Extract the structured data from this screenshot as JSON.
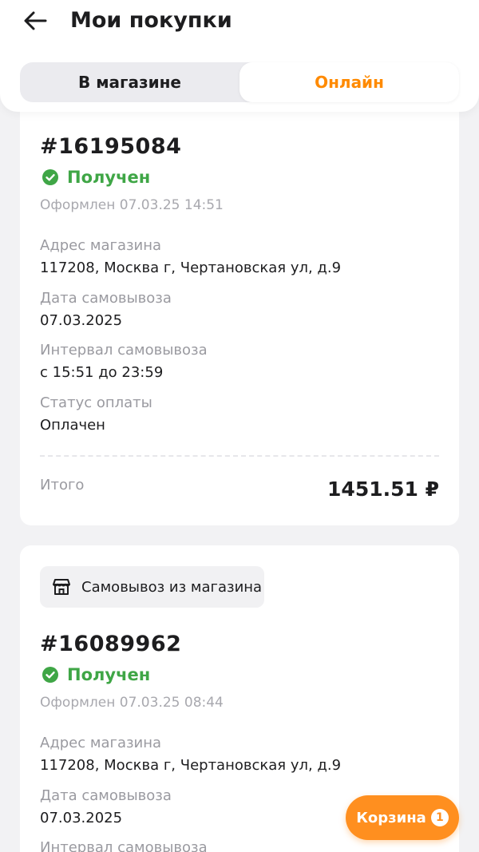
{
  "header": {
    "title": "Мои покупки",
    "back_icon": "arrow-left-icon"
  },
  "tabs": [
    {
      "label": "В магазине",
      "active": false
    },
    {
      "label": "Онлайн",
      "active": true
    }
  ],
  "orders": [
    {
      "number": "#16195084",
      "status": "Получен",
      "created": "Оформлен 07.03.25 14:51",
      "fields": [
        {
          "label": "Адрес магазина",
          "value": "117208, Москва г, Чертановская ул, д.9"
        },
        {
          "label": "Дата самовывоза",
          "value": "07.03.2025"
        },
        {
          "label": "Интервал самовывоза",
          "value": "с 15:51 до 23:59"
        },
        {
          "label": "Статус оплаты",
          "value": "Оплачен"
        }
      ],
      "total_label": "Итого",
      "total_value": "1451.51 ₽"
    },
    {
      "delivery_type": "Самовывоз из магазина",
      "number": "#16089962",
      "status": "Получен",
      "created": "Оформлен 07.03.25 08:44",
      "fields": [
        {
          "label": "Адрес магазина",
          "value": "117208, Москва г, Чертановская ул, д.9"
        },
        {
          "label": "Дата самовывоза",
          "value": "07.03.2025"
        },
        {
          "label": "Интервал самовывоза",
          "value": ""
        }
      ]
    }
  ],
  "cart": {
    "label": "Корзина",
    "count": "1"
  },
  "colors": {
    "accent": "#ff8a00",
    "success": "#3fa646"
  }
}
